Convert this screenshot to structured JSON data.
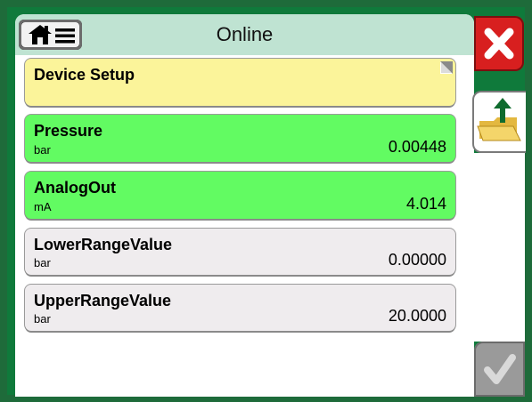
{
  "header": {
    "title": "Online",
    "home_icon": "home-icon",
    "menu_icon": "menu-icon"
  },
  "items": [
    {
      "label": "Device Setup",
      "unit": "",
      "value": "",
      "color": "#fbf49a"
    },
    {
      "label": "Pressure",
      "unit": "bar",
      "value": "0.00448",
      "color": "#62fb62"
    },
    {
      "label": "AnalogOut",
      "unit": "mA",
      "value": "4.014",
      "color": "#62fb62"
    },
    {
      "label": "LowerRangeValue",
      "unit": "bar",
      "value": "0.00000",
      "color": "#efecee"
    },
    {
      "label": "UpperRangeValue",
      "unit": "bar",
      "value": "20.0000",
      "color": "#efecee"
    }
  ],
  "side": {
    "close_icon": "close-icon",
    "export_icon": "folder-upload-icon",
    "ok_icon": "checkmark-icon"
  },
  "colors": {
    "frame": "#0f7a3b",
    "titlebar": "#bfe3d2",
    "close": "#d81f1f",
    "ok_disabled": "#9a9a9a"
  }
}
